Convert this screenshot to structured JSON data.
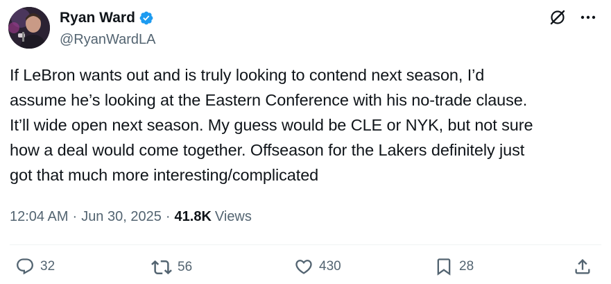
{
  "author": {
    "display_name": "Ryan Ward",
    "handle": "@RyanWardLA",
    "verified": true,
    "verified_color": "#1d9bf0"
  },
  "header_icons": [
    "grok-icon",
    "more-icon"
  ],
  "tweet": {
    "lines": [
      "If LeBron wants out and is truly looking to contend next season, I’d",
      "assume he’s looking at the Eastern Conference with his no-trade clause.",
      "It’ll wide open next season. My guess would be CLE or NYK, but not sure",
      "how a deal would come together. Offseason for the Lakers definitely just",
      "got that much more interesting/complicated"
    ]
  },
  "meta": {
    "time": "12:04 AM",
    "separator": "·",
    "date": "Jun 30, 2025",
    "views_count": "41.8K",
    "views_label": "Views"
  },
  "actions": {
    "replies": "32",
    "reposts": "56",
    "likes": "430",
    "bookmarks": "28"
  },
  "colors": {
    "text": "#0f1419",
    "secondary": "#536471",
    "divider": "#eff3f4",
    "verified": "#1d9bf0"
  }
}
